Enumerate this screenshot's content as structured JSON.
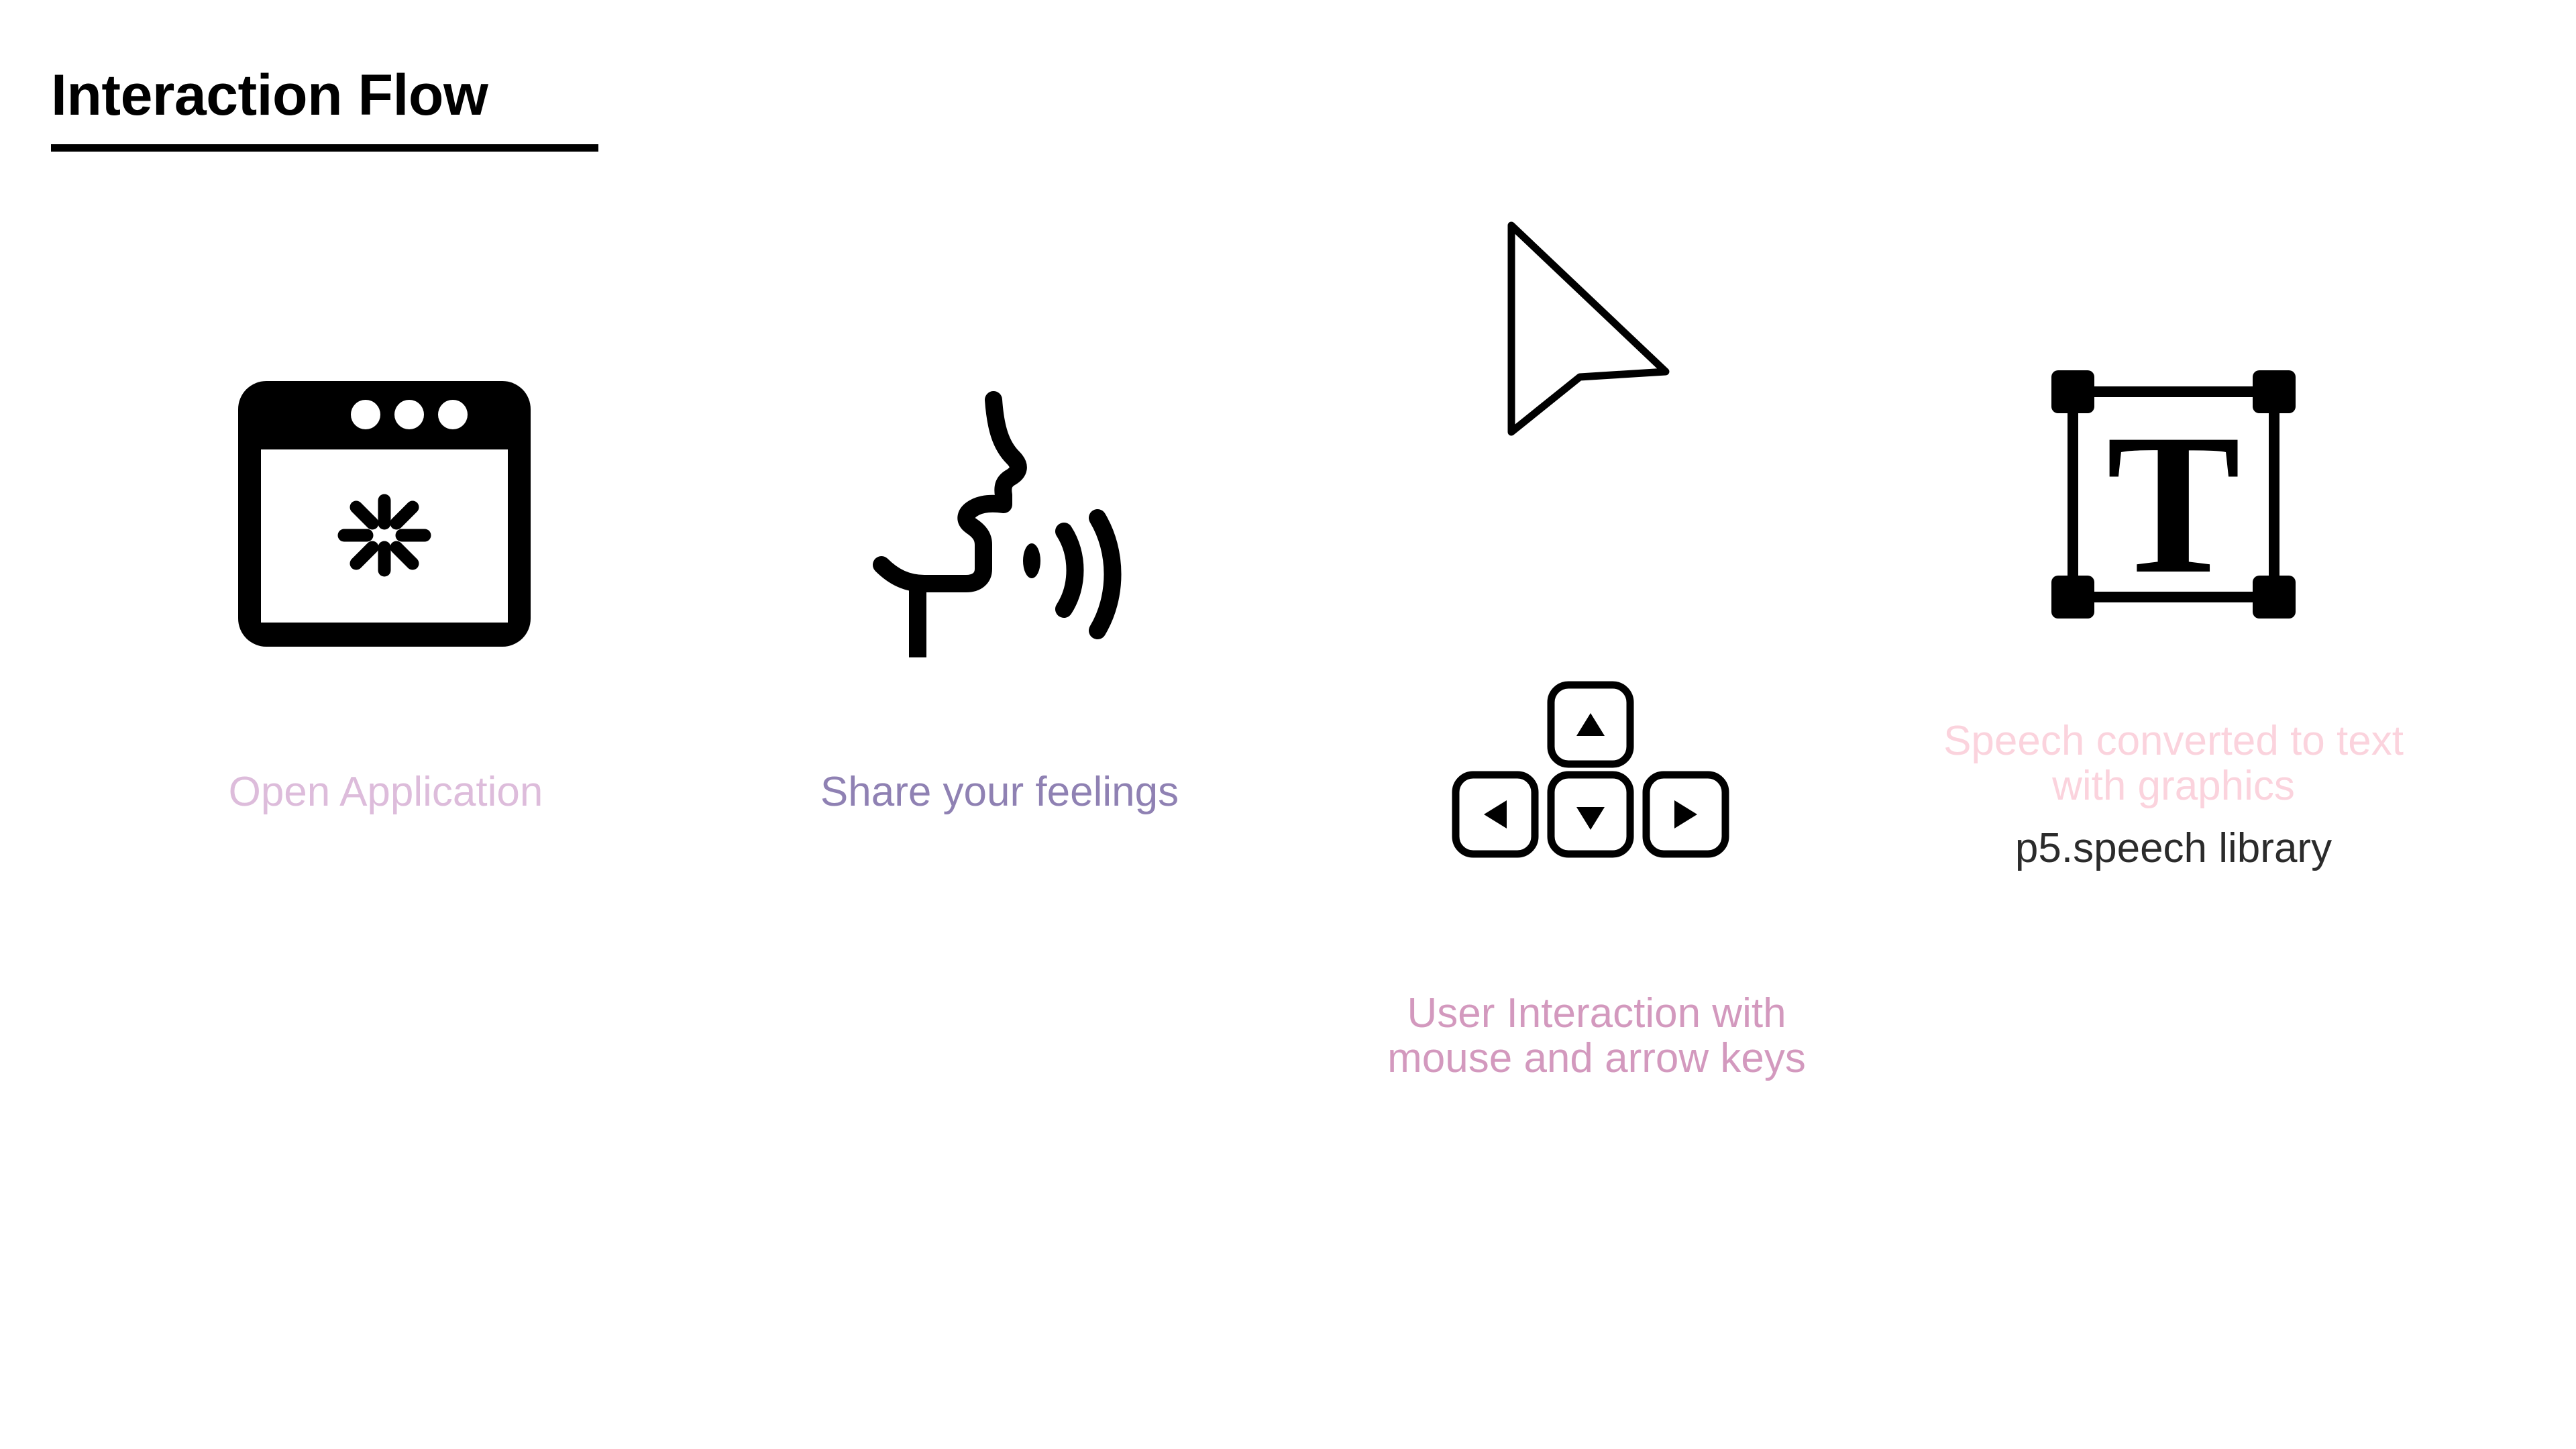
{
  "slide": {
    "title": "Interaction Flow",
    "background_color": "#ffffff"
  },
  "steps": [
    {
      "id": "open-application",
      "icon": "browser-window-loading-icon",
      "caption": "Open Application",
      "caption_color": "#ddbcdb"
    },
    {
      "id": "share-feelings",
      "icon": "speaking-head-soundwaves-icon",
      "caption": "Share your feelings",
      "caption_color": "#8f81b3"
    },
    {
      "id": "user-interaction",
      "icons": [
        "mouse-cursor-icon",
        "arrow-keys-icon"
      ],
      "caption": "User Interaction with\nmouse and arrow keys",
      "caption_color": "#d399be",
      "keys": {
        "up": "▲",
        "left": "◀",
        "down": "▼",
        "right": "▶"
      }
    },
    {
      "id": "speech-to-text",
      "icon": "text-box-selection-icon",
      "caption": "Speech converted to text\nwith graphics",
      "caption_color": "#fbd3dd",
      "sub_caption": "p5.speech library",
      "sub_caption_color": "#2b2b2b",
      "glyph": "T"
    }
  ]
}
